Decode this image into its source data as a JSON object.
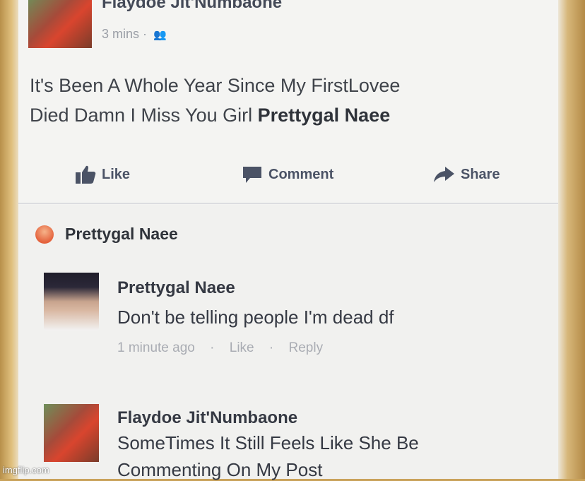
{
  "post": {
    "author": "Flaydoe Jit'Numbaone",
    "time": "3 mins",
    "dot": "·",
    "text_line1": "It's Been A Whole Year Since My FirstLovee",
    "text_line2": "Died Damn I Miss You Girl",
    "mention": "Prettygal Naee",
    "actions": {
      "like": "Like",
      "comment": "Comment",
      "share": "Share"
    }
  },
  "reaction": {
    "name": "Prettygal Naee",
    "icon": "angry-reaction-icon"
  },
  "comments": [
    {
      "name": "Prettygal Naee",
      "text": "Don't be telling people I'm dead df",
      "time": "1 minute ago",
      "like": "Like",
      "reply": "Reply",
      "dot": "·"
    },
    {
      "name": "Flaydoe Jit'Numbaone",
      "text_line1": "SomeTimes It Still Feels Like She Be",
      "text_line2": "Commenting On My Post"
    }
  ],
  "watermark": "imgflip.com",
  "colors": {
    "link": "#4b5366",
    "text": "#353943",
    "meta": "#a9acb3"
  }
}
